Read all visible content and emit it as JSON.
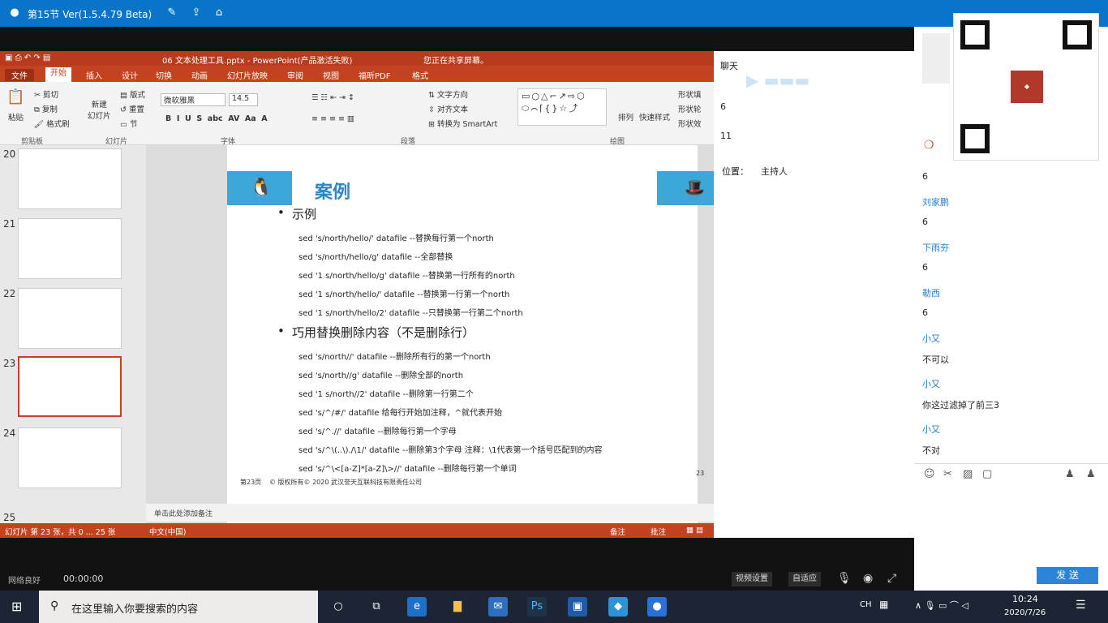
{
  "title_bar": {
    "title": "第15节 Ver(1.5.4.79 Beta)"
  },
  "ppt": {
    "titlebar_text": "06 文本处理工具.pptx - PowerPoint(产品激活失败)",
    "share_notice": "您正在共享屏幕。",
    "tabs": [
      "文件",
      "开始",
      "插入",
      "设计",
      "切换",
      "动画",
      "幻灯片放映",
      "审阅",
      "视图",
      "福昕PDF",
      "格式"
    ],
    "ribbon": {
      "paste": "粘贴",
      "cut": "剪切",
      "copy": "复制",
      "format_painter": "格式刷",
      "new_slide": "新建\n幻灯片",
      "layout": "版式",
      "reset": "重置",
      "section": "节",
      "font_name": "微软雅黑",
      "font_size": "14.5",
      "text_direction": "文字方向",
      "align_text": "对齐文本",
      "convert_smartart": "转换为 SmartArt",
      "arrange": "排列",
      "quick_styles": "快速样式",
      "shape_fill": "形状填",
      "shape_outline": "形状轮",
      "shape_effects": "形状效"
    },
    "groups": [
      "剪贴板",
      "幻灯片",
      "字体",
      "段落",
      "绘图"
    ],
    "thumb_numbers": [
      "20",
      "21",
      "22",
      "23",
      "24",
      "25"
    ],
    "slide": {
      "heading": "案例",
      "bullet1": "示例",
      "lines1": [
        "sed 's/north/hello/' datafile --替换每行第一个north",
        "sed 's/north/hello/g' datafile --全部替换",
        "sed '1 s/north/hello/g' datafile --替换第一行所有的north",
        "sed '1 s/north/hello/' datafile --替换第一行第一个north",
        "sed '1 s/north/hello/2' datafile --只替换第一行第二个north"
      ],
      "bullet2": "巧用替换删除内容（不是删除行）",
      "lines2": [
        "sed 's/north//' datafile --删除所有行的第一个north",
        "sed 's/north//g' datafile --删除全部的north",
        "sed '1 s/north//2' datafile --删除第一行第二个",
        "sed 's/^/#/'  datafile  给每行开始加注释，^就代表开始",
        "sed 's/^.//' datafile --删除每行第一个字母",
        "sed 's/^\\(..\\)./\\1/' datafile --删除第3个字母  注释：\\1代表第一个括号匹配到的内容",
        "sed 's/^\\<[a-Z]*[a-Z]\\>//' datafile --删除每行第一个单词"
      ],
      "footer_page": "第23页",
      "footer_copy": "© 版权所有© 2020 武汉誉天互联科技有限责任公司",
      "page_num": "23"
    },
    "notes": "单击此处添加备注",
    "status_left": "幻灯片 第 23 张，共 0 ... 25 张",
    "status_lang": "中文(中国)",
    "status_notes": "备注",
    "status_comments": "批注"
  },
  "chat_panel": {
    "title": "聊天",
    "nums": [
      "6",
      "11"
    ],
    "position_label": "位置：",
    "position_value": "主持人"
  },
  "side_chat": {
    "messages": [
      {
        "name": "",
        "text": "6"
      },
      {
        "name": "刘家鹏",
        "text": "6"
      },
      {
        "name": "下雨夯",
        "text": "6"
      },
      {
        "name": "勒西",
        "text": "6"
      },
      {
        "name": "小又",
        "text": "不可以"
      },
      {
        "name": "小又",
        "text": "你这过滤掉了前三3"
      },
      {
        "name": "小又",
        "text": "不对"
      }
    ],
    "send": "发 送"
  },
  "bottom": {
    "network": "网络良好",
    "time": "00:00:00",
    "video_settings": "视频设置",
    "adaptive": "自适应"
  },
  "taskbar": {
    "search_placeholder": "在这里输入你要搜索的内容",
    "ime": "CH",
    "clock_time": "10:24",
    "clock_date": "2020/7/26"
  }
}
